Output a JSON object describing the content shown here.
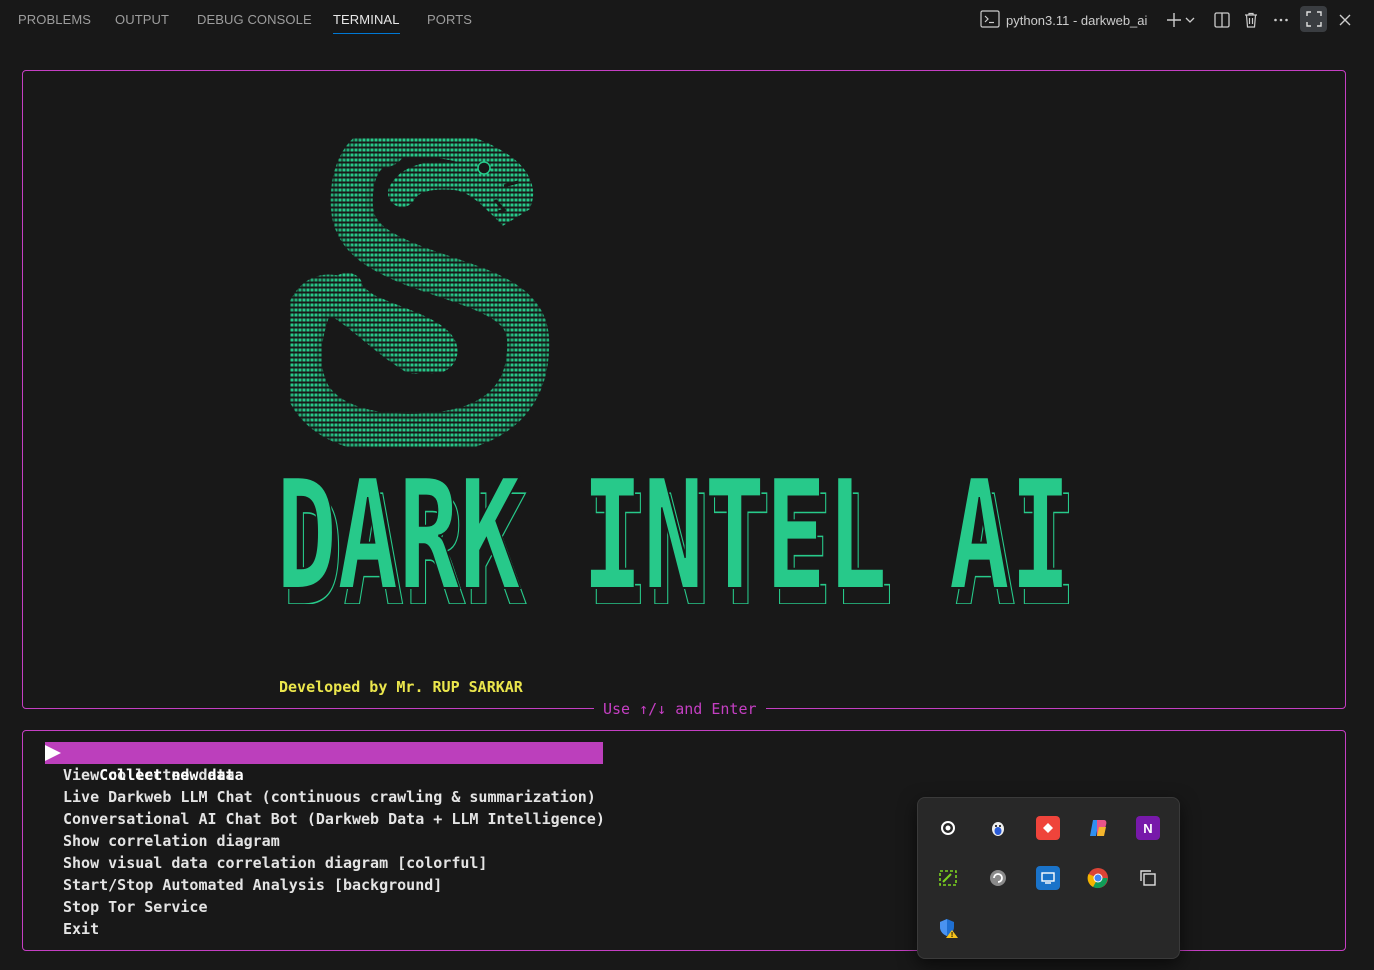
{
  "panel": {
    "tabs": [
      {
        "label": "PROBLEMS"
      },
      {
        "label": "OUTPUT"
      },
      {
        "label": "DEBUG CONSOLE"
      },
      {
        "label": "TERMINAL"
      },
      {
        "label": "PORTS"
      }
    ],
    "active_tab": "TERMINAL",
    "terminal_name": "python3.11 - darkweb_ai"
  },
  "banner": {
    "title": "DARK INTEL AI",
    "developer": "Developed by Mr. RUP SARKAR",
    "hint": "Use ↑/↓ and Enter",
    "accent_color": "#27c98a",
    "border_color": "#c53fc3",
    "developer_color": "#ebe64c"
  },
  "menu": {
    "items": [
      {
        "label": "Collect new data",
        "selected": true
      },
      {
        "label": "View collected data"
      },
      {
        "label": "Live Darkweb LLM Chat (continuous crawling & summarization)"
      },
      {
        "label": "Conversational AI Chat Bot (Darkweb Data + LLM Intelligence)"
      },
      {
        "label": "Show correlation diagram"
      },
      {
        "label": "Show visual data correlation diagram [colorful]"
      },
      {
        "label": "Start/Stop Automated Analysis [background]"
      },
      {
        "label": "Stop Tor Service"
      },
      {
        "label": "Exit"
      }
    ],
    "highlight_color": "#bc3fbc"
  },
  "tray": {
    "icons": [
      "steam-icon",
      "penguin-app-icon",
      "anydesk-icon",
      "copilot-icon",
      "onenote-icon",
      "pencil-app-icon",
      "sync-icon",
      "remote-desktop-icon",
      "chrome-icon",
      "copy-windows-icon",
      "defender-warning-icon"
    ]
  }
}
